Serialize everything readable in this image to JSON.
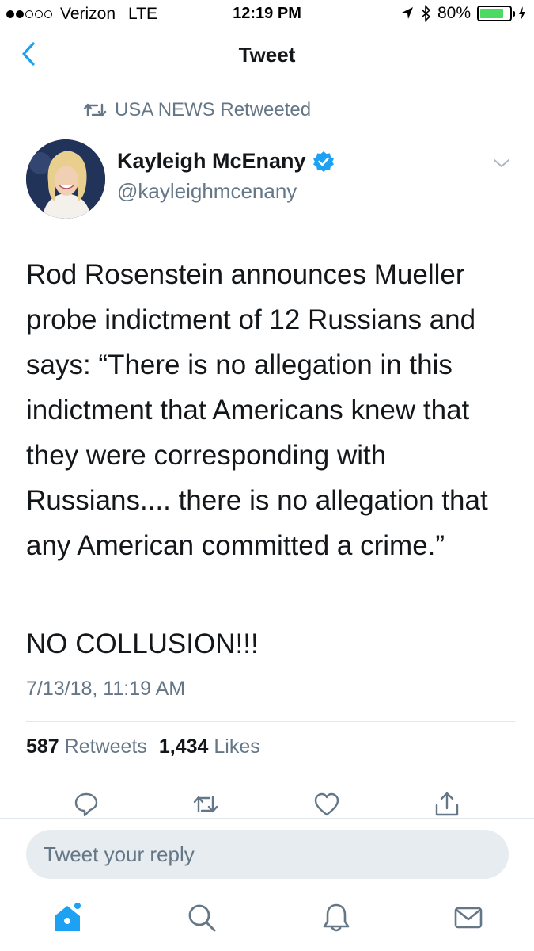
{
  "status_bar": {
    "carrier": "Verizon",
    "network": "LTE",
    "time": "12:19 PM",
    "battery": "80%",
    "battery_level": 0.8,
    "battery_color": "#4cd964"
  },
  "nav": {
    "title": "Tweet",
    "back_icon": "chevron-left-icon"
  },
  "retweet_context": {
    "text": "USA NEWS Retweeted"
  },
  "author": {
    "name": "Kayleigh McEnany",
    "handle": "@kayleighmcenany",
    "verified": true
  },
  "tweet": {
    "text": "Rod Rosenstein announces Mueller probe indictment of 12 Russians and says: “There is no allegation in this indictment that Americans knew that they were corresponding with Russians.... there is no allegation that any American committed a crime.”",
    "emphasis": "NO COLLUSION!!!",
    "timestamp": "7/13/18, 11:19 AM"
  },
  "stats": {
    "retweets_count": "587",
    "retweets_label": "Retweets",
    "likes_count": "1,434",
    "likes_label": "Likes"
  },
  "actions": [
    "reply-icon",
    "retweet-icon",
    "like-icon",
    "share-icon"
  ],
  "reply": {
    "placeholder": "Tweet your reply"
  },
  "tabs": [
    "home-icon",
    "search-icon",
    "notifications-icon",
    "messages-icon"
  ],
  "colors": {
    "accent": "#1da1f2",
    "muted": "#657786",
    "text": "#14171a",
    "divider": "#e1e8ed"
  }
}
